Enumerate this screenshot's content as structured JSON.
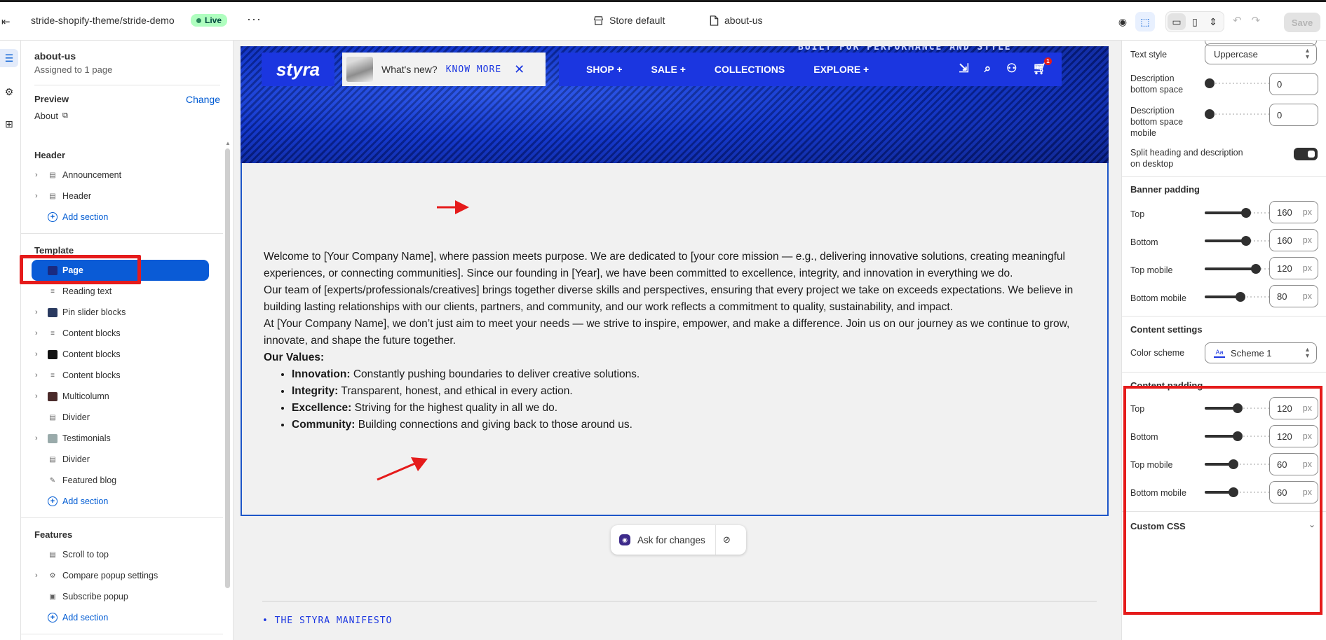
{
  "topbar": {
    "theme_path": "stride-shopify-theme/stride-demo",
    "live_label": "Live",
    "more_label": "···",
    "store_label": "Store default",
    "page_label": "about-us",
    "save_label": "Save"
  },
  "sidebar": {
    "title": "about-us",
    "subtitle": "Assigned to 1 page",
    "preview_label": "Preview",
    "change_label": "Change",
    "preview_page": "About",
    "groups": [
      {
        "label": "Header",
        "items": [
          {
            "label": "Announcement",
            "chevron": true
          },
          {
            "label": "Header",
            "chevron": true
          }
        ],
        "add": "Add section"
      },
      {
        "label": "Template",
        "items": [
          {
            "label": "Page",
            "chevron": false,
            "selected": true
          },
          {
            "label": "Reading text",
            "chevron": false
          },
          {
            "label": "Pin slider blocks",
            "chevron": true
          },
          {
            "label": "Content blocks",
            "chevron": true
          },
          {
            "label": "Content blocks",
            "chevron": true
          },
          {
            "label": "Content blocks",
            "chevron": true
          },
          {
            "label": "Multicolumn",
            "chevron": true
          },
          {
            "label": "Divider",
            "chevron": false
          },
          {
            "label": "Testimonials",
            "chevron": true
          },
          {
            "label": "Divider",
            "chevron": false
          },
          {
            "label": "Featured blog",
            "chevron": false
          }
        ],
        "add": "Add section"
      },
      {
        "label": "Features",
        "items": [
          {
            "label": "Scroll to top",
            "chevron": false
          },
          {
            "label": "Compare popup settings",
            "chevron": true
          },
          {
            "label": "Subscribe popup",
            "chevron": false
          }
        ],
        "add": "Add section"
      }
    ]
  },
  "preview": {
    "hero_text": "BUILT FOR PERFORMANCE AND STYLE",
    "logo": "styra",
    "promo_text": "What's new?",
    "promo_link": "KNOW MORE",
    "nav": [
      "SHOP +",
      "SALE +",
      "COLLECTIONS",
      "EXPLORE +"
    ],
    "cart_count": "1",
    "para1": "Welcome to [Your Company Name], where passion meets purpose. We are dedicated to [your core mission — e.g., delivering innovative solutions, creating meaningful experiences, or connecting communities]. Since our founding in [Year], we have been committed to excellence, integrity, and innovation in everything we do.",
    "para2": "Our team of [experts/professionals/creatives] brings together diverse skills and perspectives, ensuring that every project we take on exceeds expectations. We believe in building lasting relationships with our clients, partners, and community, and our work reflects a commitment to quality, sustainability, and impact.",
    "para3": "At [Your Company Name], we don’t just aim to meet your needs — we strive to inspire, empower, and make a difference. Join us on our journey as we continue to grow, innovate, and shape the future together.",
    "values_heading": "Our Values:",
    "values": [
      {
        "term": "Innovation:",
        "text": " Constantly pushing boundaries to deliver creative solutions."
      },
      {
        "term": "Integrity:",
        "text": " Transparent, honest, and ethical in every action."
      },
      {
        "term": "Excellence:",
        "text": " Striving for the highest quality in all we do."
      },
      {
        "term": "Community:",
        "text": " Building connections and giving back to those around us."
      }
    ],
    "ask_label": "Ask for changes",
    "manifesto": "• THE STYRA MANIFESTO"
  },
  "settings": {
    "text_style_label": "Text style",
    "text_style_value": "Uppercase",
    "desc_bottom_label": "Description bottom space",
    "desc_bottom_value": "0",
    "desc_bottom_mobile_label": "Description bottom space mobile",
    "desc_bottom_mobile_value": "0",
    "split_label": "Split heading and description on desktop",
    "banner_padding_heading": "Banner padding",
    "banner_top_label": "Top",
    "banner_top_value": "160",
    "banner_bottom_label": "Bottom",
    "banner_bottom_value": "160",
    "banner_top_mobile_label": "Top mobile",
    "banner_top_mobile_value": "120",
    "banner_bottom_mobile_label": "Bottom mobile",
    "banner_bottom_mobile_value": "80",
    "content_settings_heading": "Content settings",
    "color_scheme_label": "Color scheme",
    "color_scheme_value": "Scheme 1",
    "content_padding_heading": "Content padding",
    "content_top_label": "Top",
    "content_top_value": "120",
    "content_bottom_label": "Bottom",
    "content_bottom_value": "120",
    "content_top_mobile_label": "Top mobile",
    "content_top_mobile_value": "60",
    "content_bottom_mobile_label": "Bottom mobile",
    "content_bottom_mobile_value": "60",
    "unit": "px",
    "custom_css_label": "Custom CSS"
  },
  "colors": {
    "accent": "#005bd3",
    "brand_blue": "#1b36e0",
    "annotation_red": "#e51b1b"
  }
}
